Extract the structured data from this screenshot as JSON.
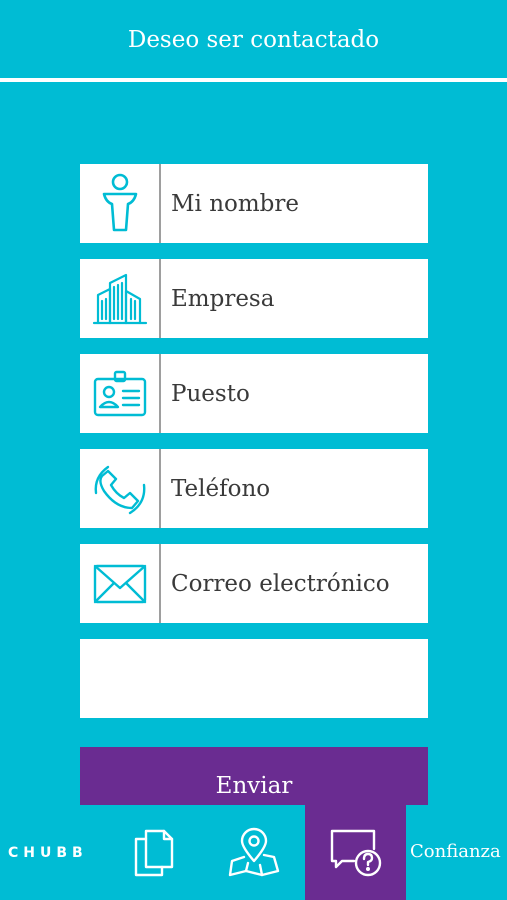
{
  "header": {
    "title": "Deseo ser contactado"
  },
  "form": {
    "fields": [
      {
        "label": "Mi nombre",
        "icon": "person-icon"
      },
      {
        "label": "Empresa",
        "icon": "buildings-icon"
      },
      {
        "label": "Puesto",
        "icon": "id-card-icon"
      },
      {
        "label": "Teléfono",
        "icon": "phone-icon"
      },
      {
        "label": "Correo electrónico",
        "icon": "envelope-icon"
      },
      {
        "label": "",
        "icon": ""
      }
    ],
    "submit_label": "Enviar"
  },
  "bottom_nav": {
    "brand": "CHUBB",
    "items": [
      {
        "icon": "documents-icon"
      },
      {
        "icon": "map-pin-icon"
      },
      {
        "icon": "chat-help-icon",
        "active": true
      }
    ],
    "active_label": "Confianza"
  },
  "colors": {
    "background": "#00BCD4",
    "accent": "#6A2C91",
    "field_bg": "#ffffff",
    "icon_stroke": "#00BCD4"
  }
}
